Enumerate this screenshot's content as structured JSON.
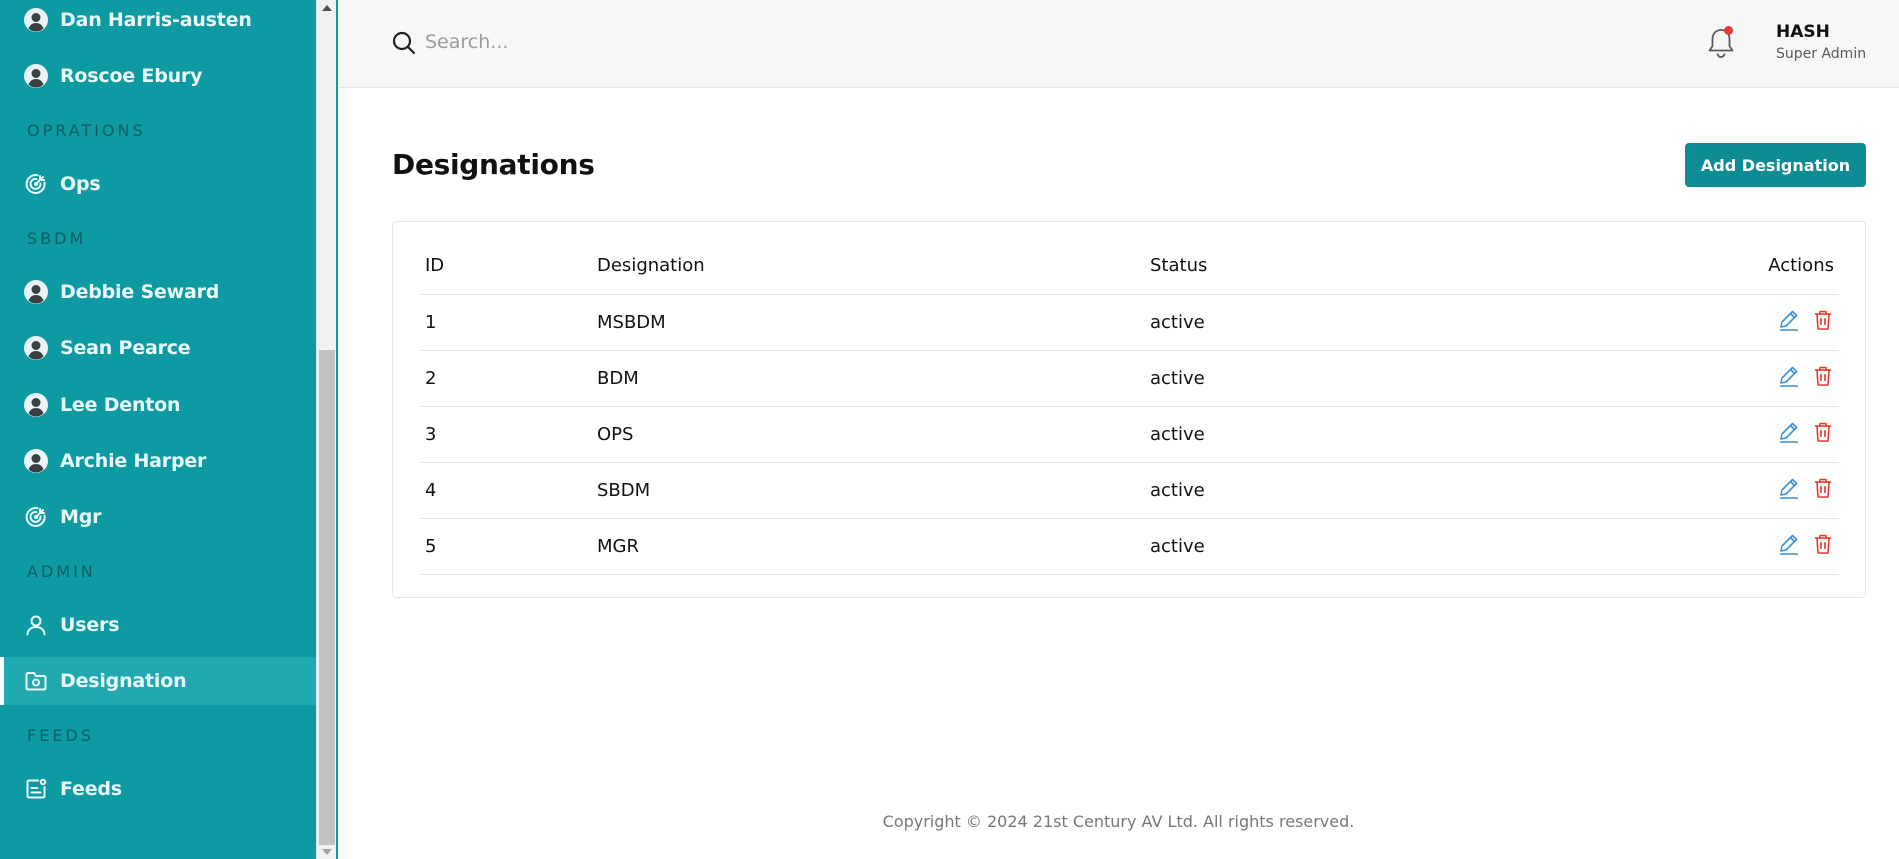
{
  "sidebar": {
    "items": [
      {
        "label": "Dan Harris-austen",
        "icon": "avatar-icon"
      },
      {
        "label": "Roscoe Ebury",
        "icon": "avatar-icon"
      },
      {
        "label": "Ops",
        "icon": "target-icon"
      },
      {
        "label": "Debbie Seward",
        "icon": "avatar-icon"
      },
      {
        "label": "Sean Pearce",
        "icon": "avatar-icon"
      },
      {
        "label": "Lee Denton",
        "icon": "avatar-icon"
      },
      {
        "label": "Archie Harper",
        "icon": "avatar-icon"
      },
      {
        "label": "Mgr",
        "icon": "target-icon"
      },
      {
        "label": "Users",
        "icon": "user-icon"
      },
      {
        "label": "Designation",
        "icon": "folder-badge-icon",
        "active": true
      },
      {
        "label": "Feeds",
        "icon": "feed-icon"
      }
    ],
    "sections": [
      "OPRATIONS",
      "SBDM",
      "ADMIN",
      "FEEDS"
    ]
  },
  "topbar": {
    "search_placeholder": "Search...",
    "user_name": "HASH",
    "user_role": "Super Admin"
  },
  "main": {
    "title": "Designations",
    "add_button_label": "Add Designation",
    "table": {
      "columns": [
        "ID",
        "Designation",
        "Status",
        "Actions"
      ],
      "rows": [
        {
          "id": "1",
          "designation": "MSBDM",
          "status": "active"
        },
        {
          "id": "2",
          "designation": "BDM",
          "status": "active"
        },
        {
          "id": "3",
          "designation": "OPS",
          "status": "active"
        },
        {
          "id": "4",
          "designation": "SBDM",
          "status": "active"
        },
        {
          "id": "5",
          "designation": "MGR",
          "status": "active"
        }
      ]
    }
  },
  "footer": {
    "text": "Copyright © 2024 21st Century AV Ltd. All rights reserved."
  },
  "colors": {
    "sidebar": "#0e9aa3",
    "accent": "#0e8c94",
    "edit": "#3d8fd1",
    "delete": "#e53935",
    "notification": "#e53935"
  }
}
